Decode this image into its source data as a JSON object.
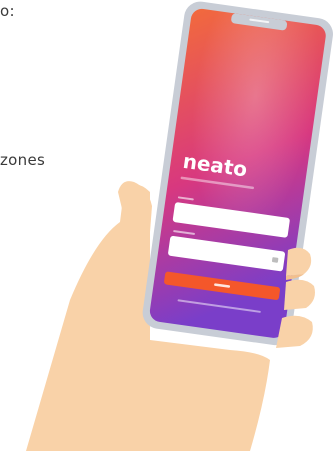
{
  "colors": {
    "background": "#ffffff",
    "text": "#3a3a3a",
    "skin": "#f9d2a8",
    "skin_shadow": "#f2bf8e",
    "phone_frame": "#c8cdd6",
    "screen_orange": "#f26a3c",
    "screen_pink": "#d8387f",
    "screen_purple": "#7a3ec9",
    "button": "#f4572a"
  },
  "snippets": {
    "line1": "o:",
    "line2": "zones"
  },
  "app": {
    "logo_text": "neato"
  }
}
